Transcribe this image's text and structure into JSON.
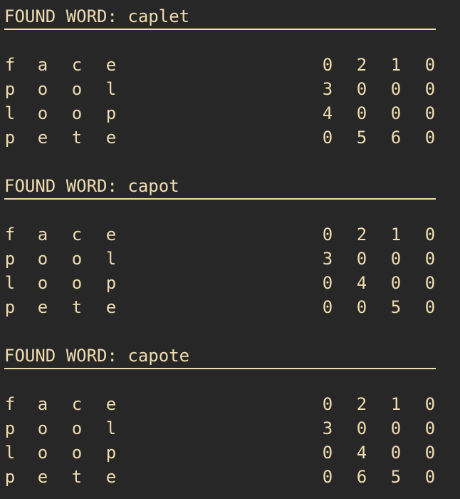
{
  "terminal": {
    "background": "#272727",
    "foreground": "#efdcb0",
    "blocks": [
      {
        "header": "FOUND WORD: caplet",
        "rows": [
          {
            "letters": [
              "f",
              "a",
              "c",
              "e"
            ],
            "numbers": [
              "0",
              "2",
              "1",
              "0"
            ]
          },
          {
            "letters": [
              "p",
              "o",
              "o",
              "l"
            ],
            "numbers": [
              "3",
              "0",
              "0",
              "0"
            ]
          },
          {
            "letters": [
              "l",
              "o",
              "o",
              "p"
            ],
            "numbers": [
              "4",
              "0",
              "0",
              "0"
            ]
          },
          {
            "letters": [
              "p",
              "e",
              "t",
              "e"
            ],
            "numbers": [
              "0",
              "5",
              "6",
              "0"
            ]
          }
        ]
      },
      {
        "header": "FOUND WORD: capot",
        "rows": [
          {
            "letters": [
              "f",
              "a",
              "c",
              "e"
            ],
            "numbers": [
              "0",
              "2",
              "1",
              "0"
            ]
          },
          {
            "letters": [
              "p",
              "o",
              "o",
              "l"
            ],
            "numbers": [
              "3",
              "0",
              "0",
              "0"
            ]
          },
          {
            "letters": [
              "l",
              "o",
              "o",
              "p"
            ],
            "numbers": [
              "0",
              "4",
              "0",
              "0"
            ]
          },
          {
            "letters": [
              "p",
              "e",
              "t",
              "e"
            ],
            "numbers": [
              "0",
              "0",
              "5",
              "0"
            ]
          }
        ]
      },
      {
        "header": "FOUND WORD: capote",
        "rows": [
          {
            "letters": [
              "f",
              "a",
              "c",
              "e"
            ],
            "numbers": [
              "0",
              "2",
              "1",
              "0"
            ]
          },
          {
            "letters": [
              "p",
              "o",
              "o",
              "l"
            ],
            "numbers": [
              "3",
              "0",
              "0",
              "0"
            ]
          },
          {
            "letters": [
              "l",
              "o",
              "o",
              "p"
            ],
            "numbers": [
              "0",
              "4",
              "0",
              "0"
            ]
          },
          {
            "letters": [
              "p",
              "e",
              "t",
              "e"
            ],
            "numbers": [
              "0",
              "6",
              "5",
              "0"
            ]
          }
        ]
      }
    ]
  }
}
